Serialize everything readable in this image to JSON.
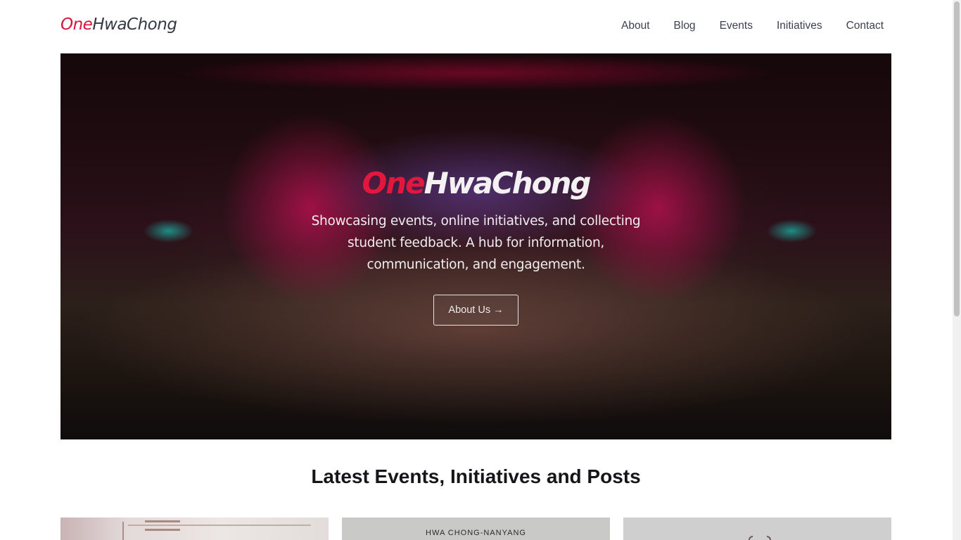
{
  "navbar": {
    "brand": {
      "part1": "One",
      "part2": "HwaChong"
    },
    "links": [
      {
        "label": "About"
      },
      {
        "label": "Blog"
      },
      {
        "label": "Events"
      },
      {
        "label": "Initiatives"
      },
      {
        "label": "Contact"
      }
    ]
  },
  "hero": {
    "title": {
      "part1": "One",
      "part2": "HwaChong"
    },
    "subtitle": "Showcasing events, online initiatives, and collecting student feedback. A hub for information, communication, and engagement.",
    "button_label": "About Us",
    "button_icon": "→"
  },
  "section": {
    "title": "Latest Events, Initiatives and Posts"
  },
  "cards": [
    {
      "caption": ""
    },
    {
      "caption": "HWA CHONG-NANYANG"
    },
    {
      "caption": ""
    }
  ],
  "colors": {
    "brand_red": "#d5153a",
    "brand_dark": "#333a44",
    "nav_text": "#3b4150"
  }
}
